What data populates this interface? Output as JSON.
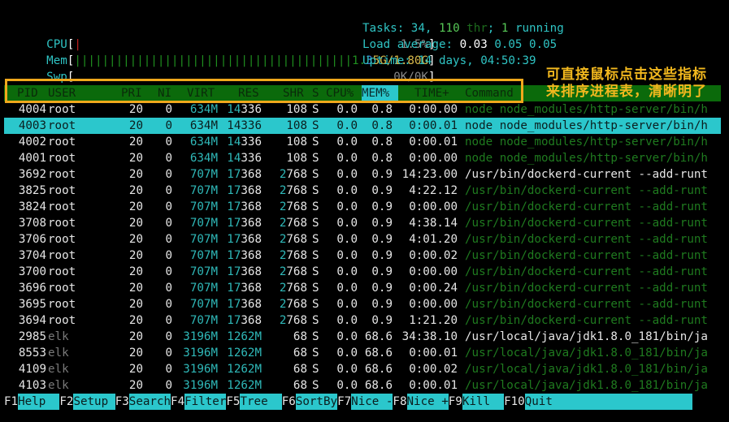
{
  "meters": {
    "cpu": {
      "label": "CPU",
      "value_text": "1.5%",
      "percent": 1.5
    },
    "mem": {
      "label": "Mem",
      "used": "1.35G",
      "total": "1.80G",
      "fraction": 0.75
    },
    "swp": {
      "label": "Swp",
      "value_text": "0K/0K",
      "fraction": 0
    }
  },
  "sysinfo": {
    "tasks_label": "Tasks: ",
    "tasks": "34",
    "threads": "110",
    "threads_label": "thr",
    "running": "1",
    "running_label": "running",
    "load_label": "Load average: ",
    "load": [
      "0.03",
      "0.05",
      "0.05"
    ],
    "uptime_label": "Uptime: ",
    "uptime": "14 days, 04:50:39"
  },
  "columns": [
    "PID",
    "USER",
    "PRI",
    "NI",
    "VIRT",
    "RES",
    "SHR",
    "S",
    "CPU%",
    "MEM%",
    "TIME+",
    "Command"
  ],
  "sorted_column": "MEM%",
  "annotation": "可直接鼠标点击这些指标来排序进程表，清晰明了",
  "processes": [
    {
      "pid": "4004",
      "user": "root",
      "pri": "20",
      "ni": "0",
      "virt": "634M",
      "res": "14336",
      "shr": "108",
      "s": "S",
      "cpu": "0.0",
      "mem": "0.8",
      "time": "0:00.00",
      "cmd": "node node_modules/http-server/bin/h",
      "thread": true
    },
    {
      "pid": "4003",
      "user": "root",
      "pri": "20",
      "ni": "0",
      "virt": "634M",
      "res": "14336",
      "shr": "108",
      "s": "S",
      "cpu": "0.0",
      "mem": "0.8",
      "time": "0:00.01",
      "cmd": "node node_modules/http-server/bin/h",
      "thread": false,
      "selected": true
    },
    {
      "pid": "4002",
      "user": "root",
      "pri": "20",
      "ni": "0",
      "virt": "634M",
      "res": "14336",
      "shr": "108",
      "s": "S",
      "cpu": "0.0",
      "mem": "0.8",
      "time": "0:00.01",
      "cmd": "node node_modules/http-server/bin/h",
      "thread": true
    },
    {
      "pid": "4001",
      "user": "root",
      "pri": "20",
      "ni": "0",
      "virt": "634M",
      "res": "14336",
      "shr": "108",
      "s": "S",
      "cpu": "0.0",
      "mem": "0.8",
      "time": "0:00.00",
      "cmd": "node node_modules/http-server/bin/h",
      "thread": true
    },
    {
      "pid": "3692",
      "user": "root",
      "pri": "20",
      "ni": "0",
      "virt": "707M",
      "res": "17368",
      "shr": "2768",
      "s": "S",
      "cpu": "0.0",
      "mem": "0.9",
      "time": "14:23.00",
      "cmd": "/usr/bin/dockerd-current --add-runt",
      "thread": false
    },
    {
      "pid": "3825",
      "user": "root",
      "pri": "20",
      "ni": "0",
      "virt": "707M",
      "res": "17368",
      "shr": "2768",
      "s": "S",
      "cpu": "0.0",
      "mem": "0.9",
      "time": "4:22.12",
      "cmd": "/usr/bin/dockerd-current --add-runt",
      "thread": true
    },
    {
      "pid": "3824",
      "user": "root",
      "pri": "20",
      "ni": "0",
      "virt": "707M",
      "res": "17368",
      "shr": "2768",
      "s": "S",
      "cpu": "0.0",
      "mem": "0.9",
      "time": "0:00.00",
      "cmd": "/usr/bin/dockerd-current --add-runt",
      "thread": true
    },
    {
      "pid": "3708",
      "user": "root",
      "pri": "20",
      "ni": "0",
      "virt": "707M",
      "res": "17368",
      "shr": "2768",
      "s": "S",
      "cpu": "0.0",
      "mem": "0.9",
      "time": "4:38.14",
      "cmd": "/usr/bin/dockerd-current --add-runt",
      "thread": true
    },
    {
      "pid": "3706",
      "user": "root",
      "pri": "20",
      "ni": "0",
      "virt": "707M",
      "res": "17368",
      "shr": "2768",
      "s": "S",
      "cpu": "0.0",
      "mem": "0.9",
      "time": "4:01.20",
      "cmd": "/usr/bin/dockerd-current --add-runt",
      "thread": true
    },
    {
      "pid": "3704",
      "user": "root",
      "pri": "20",
      "ni": "0",
      "virt": "707M",
      "res": "17368",
      "shr": "2768",
      "s": "S",
      "cpu": "0.0",
      "mem": "0.9",
      "time": "0:00.02",
      "cmd": "/usr/bin/dockerd-current --add-runt",
      "thread": true
    },
    {
      "pid": "3700",
      "user": "root",
      "pri": "20",
      "ni": "0",
      "virt": "707M",
      "res": "17368",
      "shr": "2768",
      "s": "S",
      "cpu": "0.0",
      "mem": "0.9",
      "time": "0:00.00",
      "cmd": "/usr/bin/dockerd-current --add-runt",
      "thread": true
    },
    {
      "pid": "3696",
      "user": "root",
      "pri": "20",
      "ni": "0",
      "virt": "707M",
      "res": "17368",
      "shr": "2768",
      "s": "S",
      "cpu": "0.0",
      "mem": "0.9",
      "time": "0:00.24",
      "cmd": "/usr/bin/dockerd-current --add-runt",
      "thread": true
    },
    {
      "pid": "3695",
      "user": "root",
      "pri": "20",
      "ni": "0",
      "virt": "707M",
      "res": "17368",
      "shr": "2768",
      "s": "S",
      "cpu": "0.0",
      "mem": "0.9",
      "time": "0:00.00",
      "cmd": "/usr/bin/dockerd-current --add-runt",
      "thread": true
    },
    {
      "pid": "3694",
      "user": "root",
      "pri": "20",
      "ni": "0",
      "virt": "707M",
      "res": "17368",
      "shr": "2768",
      "s": "S",
      "cpu": "0.0",
      "mem": "0.9",
      "time": "1:21.20",
      "cmd": "/usr/bin/dockerd-current --add-runt",
      "thread": true
    },
    {
      "pid": "2985",
      "user": "elk",
      "pri": "20",
      "ni": "0",
      "virt": "3196M",
      "res": "1262M",
      "shr": "68",
      "s": "S",
      "cpu": "0.0",
      "mem": "68.6",
      "time": "34:38.10",
      "cmd": "/usr/local/java/jdk1.8.0_181/bin/ja",
      "thread": false
    },
    {
      "pid": "8553",
      "user": "elk",
      "pri": "20",
      "ni": "0",
      "virt": "3196M",
      "res": "1262M",
      "shr": "68",
      "s": "S",
      "cpu": "0.0",
      "mem": "68.6",
      "time": "0:00.01",
      "cmd": "/usr/local/java/jdk1.8.0_181/bin/ja",
      "thread": true
    },
    {
      "pid": "4109",
      "user": "elk",
      "pri": "20",
      "ni": "0",
      "virt": "3196M",
      "res": "1262M",
      "shr": "68",
      "s": "S",
      "cpu": "0.0",
      "mem": "68.6",
      "time": "0:00.02",
      "cmd": "/usr/local/java/jdk1.8.0_181/bin/ja",
      "thread": true
    },
    {
      "pid": "4103",
      "user": "elk",
      "pri": "20",
      "ni": "0",
      "virt": "3196M",
      "res": "1262M",
      "shr": "68",
      "s": "S",
      "cpu": "0.0",
      "mem": "68.6",
      "time": "0:00.01",
      "cmd": "/usr/local/java/jdk1.8.0_181/bin/ja",
      "thread": true
    }
  ],
  "footer": [
    {
      "key": "F1",
      "label": "Help  "
    },
    {
      "key": "F2",
      "label": "Setup "
    },
    {
      "key": "F3",
      "label": "Search"
    },
    {
      "key": "F4",
      "label": "Filter"
    },
    {
      "key": "F5",
      "label": "Tree  "
    },
    {
      "key": "F6",
      "label": "SortBy"
    },
    {
      "key": "F7",
      "label": "Nice -"
    },
    {
      "key": "F8",
      "label": "Nice +"
    },
    {
      "key": "F9",
      "label": "Kill  "
    },
    {
      "key": "F10",
      "label": "Quit"
    }
  ]
}
